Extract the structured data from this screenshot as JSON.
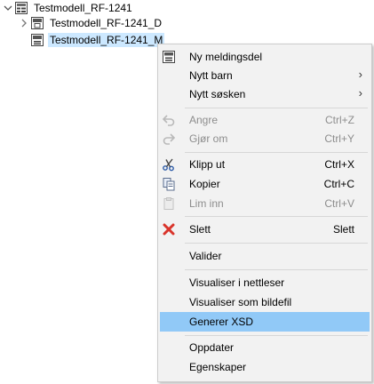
{
  "tree": {
    "root": {
      "label": "Testmodell_RF-1241"
    },
    "children": [
      {
        "label": "Testmodell_RF-1241_D"
      },
      {
        "label": "Testmodell_RF-1241_M"
      }
    ]
  },
  "context_menu": {
    "items": [
      {
        "label": "Ny meldingsdel",
        "shortcut": "",
        "icon": "new-message-part-icon"
      },
      {
        "label": "Nytt barn",
        "submenu": "›"
      },
      {
        "label": "Nytt søsken",
        "submenu": "›"
      },
      {
        "label": "Angre",
        "shortcut": "Ctrl+Z",
        "icon": "undo-icon",
        "disabled": true
      },
      {
        "label": "Gjør om",
        "shortcut": "Ctrl+Y",
        "icon": "redo-icon",
        "disabled": true
      },
      {
        "label": "Klipp ut",
        "shortcut": "Ctrl+X",
        "icon": "cut-icon"
      },
      {
        "label": "Kopier",
        "shortcut": "Ctrl+C",
        "icon": "copy-icon"
      },
      {
        "label": "Lim inn",
        "shortcut": "Ctrl+V",
        "icon": "paste-icon",
        "disabled": true
      },
      {
        "label": "Slett",
        "shortcut": "Slett",
        "icon": "delete-icon"
      },
      {
        "label": "Valider"
      },
      {
        "label": "Visualiser i nettleser"
      },
      {
        "label": "Visualiser som bildefil"
      },
      {
        "label": "Generer XSD",
        "highlighted": true
      },
      {
        "label": "Oppdater"
      },
      {
        "label": "Egenskaper"
      }
    ]
  },
  "colors": {
    "selection": "#cce8ff",
    "menu_highlight": "#91c9f7",
    "menu_background": "#f2f2f2",
    "delete_red": "#d9342b",
    "disabled_text": "#8d8d8d"
  }
}
